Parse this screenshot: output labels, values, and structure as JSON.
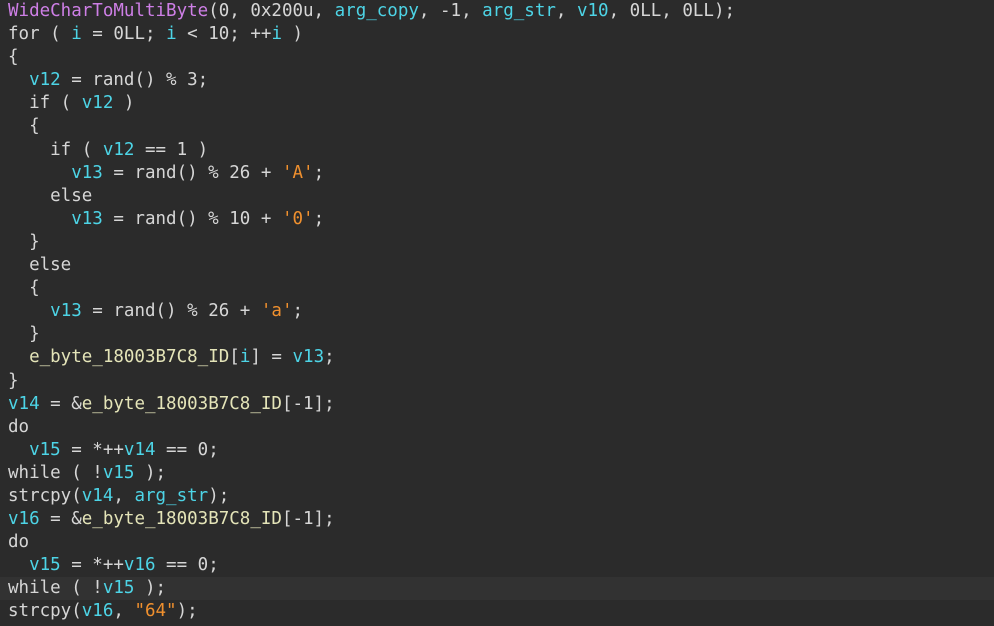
{
  "editor": {
    "highlighted_line": 25,
    "colors": {
      "background": "#2b2b2b",
      "current_line": "#323232",
      "function": "#ce7fe6",
      "variable": "#4dd4e6",
      "literal": "#f0902e",
      "plain": "#d6d6d6",
      "global": "#e4e4b8"
    },
    "lines": [
      [
        [
          "func",
          "WideCharToMultiByte"
        ],
        [
          "plain",
          "(0, 0x200u, "
        ],
        [
          "var",
          "arg_copy"
        ],
        [
          "plain",
          ", -1, "
        ],
        [
          "var",
          "arg_str"
        ],
        [
          "plain",
          ", "
        ],
        [
          "var",
          "v10"
        ],
        [
          "plain",
          ", 0LL, 0LL);"
        ]
      ],
      [
        [
          "plain",
          "for ( "
        ],
        [
          "var",
          "i"
        ],
        [
          "plain",
          " = 0LL; "
        ],
        [
          "var",
          "i"
        ],
        [
          "plain",
          " < 10; ++"
        ],
        [
          "var",
          "i"
        ],
        [
          "plain",
          " )"
        ]
      ],
      [
        [
          "plain",
          "{"
        ]
      ],
      [
        [
          "plain",
          "  "
        ],
        [
          "var",
          "v12"
        ],
        [
          "plain",
          " = rand() % 3;"
        ]
      ],
      [
        [
          "plain",
          "  if ( "
        ],
        [
          "var",
          "v12"
        ],
        [
          "plain",
          " )"
        ]
      ],
      [
        [
          "plain",
          "  {"
        ]
      ],
      [
        [
          "plain",
          "    if ( "
        ],
        [
          "var",
          "v12"
        ],
        [
          "plain",
          " == 1 )"
        ]
      ],
      [
        [
          "plain",
          "      "
        ],
        [
          "var",
          "v13"
        ],
        [
          "plain",
          " = rand() % 26 + "
        ],
        [
          "char",
          "'A'"
        ],
        [
          "plain",
          ";"
        ]
      ],
      [
        [
          "plain",
          "    else"
        ]
      ],
      [
        [
          "plain",
          "      "
        ],
        [
          "var",
          "v13"
        ],
        [
          "plain",
          " = rand() % 10 + "
        ],
        [
          "char",
          "'0'"
        ],
        [
          "plain",
          ";"
        ]
      ],
      [
        [
          "plain",
          "  }"
        ]
      ],
      [
        [
          "plain",
          "  else"
        ]
      ],
      [
        [
          "plain",
          "  {"
        ]
      ],
      [
        [
          "plain",
          "    "
        ],
        [
          "var",
          "v13"
        ],
        [
          "plain",
          " = rand() % 26 + "
        ],
        [
          "char",
          "'a'"
        ],
        [
          "plain",
          ";"
        ]
      ],
      [
        [
          "plain",
          "  }"
        ]
      ],
      [
        [
          "plain",
          "  "
        ],
        [
          "global",
          "e_byte_18003B7C8_ID"
        ],
        [
          "plain",
          "["
        ],
        [
          "var",
          "i"
        ],
        [
          "plain",
          "] = "
        ],
        [
          "var",
          "v13"
        ],
        [
          "plain",
          ";"
        ]
      ],
      [
        [
          "plain",
          "}"
        ]
      ],
      [
        [
          "var",
          "v14"
        ],
        [
          "plain",
          " = &"
        ],
        [
          "global",
          "e_byte_18003B7C8_ID"
        ],
        [
          "plain",
          "[-1];"
        ]
      ],
      [
        [
          "plain",
          "do"
        ]
      ],
      [
        [
          "plain",
          "  "
        ],
        [
          "var",
          "v15"
        ],
        [
          "plain",
          " = *++"
        ],
        [
          "var",
          "v14"
        ],
        [
          "plain",
          " == 0;"
        ]
      ],
      [
        [
          "plain",
          "while ( !"
        ],
        [
          "var",
          "v15"
        ],
        [
          "plain",
          " );"
        ]
      ],
      [
        [
          "plain",
          "strcpy("
        ],
        [
          "var",
          "v14"
        ],
        [
          "plain",
          ", "
        ],
        [
          "var",
          "arg_str"
        ],
        [
          "plain",
          ");"
        ]
      ],
      [
        [
          "var",
          "v16"
        ],
        [
          "plain",
          " = &"
        ],
        [
          "global",
          "e_byte_18003B7C8_ID"
        ],
        [
          "plain",
          "[-1];"
        ]
      ],
      [
        [
          "plain",
          "do"
        ]
      ],
      [
        [
          "plain",
          "  "
        ],
        [
          "var",
          "v15"
        ],
        [
          "plain",
          " = *++"
        ],
        [
          "var",
          "v16"
        ],
        [
          "plain",
          " == 0;"
        ]
      ],
      [
        [
          "plain",
          "while ( !"
        ],
        [
          "var",
          "v15"
        ],
        [
          "plain",
          " );"
        ]
      ],
      [
        [
          "plain",
          "strcpy("
        ],
        [
          "var",
          "v16"
        ],
        [
          "plain",
          ", "
        ],
        [
          "str",
          "\"64\""
        ],
        [
          "plain",
          ");"
        ]
      ]
    ]
  }
}
